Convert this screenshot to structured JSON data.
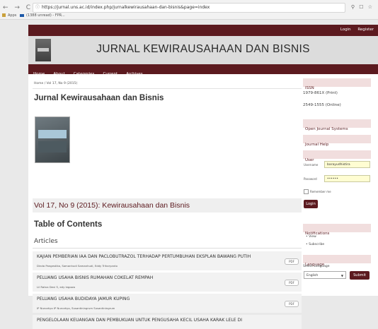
{
  "browser": {
    "nav_glyphs": "← → C ⌂",
    "url": "https://jurnal.uns.ac.id/index.php/jurnalkewirausahaan-dan-bisnis&page=index",
    "ext_glyphs": "⚲ ☐ ☆",
    "bookmarks": [
      "Apps",
      "(1388 unread) - FPR..."
    ]
  },
  "header": {
    "login": "Login",
    "register": "Register",
    "title": "JURNAL KEWIRAUSAHAAN DAN BISNIS"
  },
  "nav": [
    "Home",
    "About",
    "Categories",
    "Current",
    "Archives"
  ],
  "breadcrumb": "Home / Vol 17, No 9 (2015)",
  "page_title": "Jurnal Kewirausahaan dan Bisnis",
  "issue_title": "Vol 17, No 9 (2015): Kewirausahaan dan Bisnis",
  "toc_title": "Table of Contents",
  "articles_heading": "Articles",
  "articles": [
    {
      "title": "KAJIAN PEMBERIAN IAA DAN PACLOBUTRAZOL TERHADAP PERTUMBUHAN EKSPLAN BAWANG PUTIH",
      "authors": "Dinda Pangestika, Samanhudi Samanhudi, Eddy Triharyanto",
      "galley": "PDF"
    },
    {
      "title": "PELUANG USAHA BISNIS RUMAHAN COKELAT REMPAH",
      "authors": "Lil Ratna Devi S, edy legowo",
      "galley": "PDF"
    },
    {
      "title": "PELUANG USAHA BUDIDAYA JAMUR KUPING",
      "authors": "IP Nurcahyo IP Nurcahyo, Susantiningrum Susantiningrum",
      "galley": "PDF"
    },
    {
      "title": "PENGELOLAAN KEUANGAN DAN PEMBUKUAN UNTUK PENGUSAHA KECIL USAHA KARAK LELE DI",
      "authors": "",
      "galley": ""
    }
  ],
  "sidebar": {
    "issn_heading": "ISSN",
    "issn_print": "1979-861X (Print)",
    "issn_online": "2549-1555 (Online)",
    "ojs": "Open Journal Systems",
    "help": "Journal Help",
    "user_heading": "User",
    "username_label": "Username",
    "username_value": "barayudhistira",
    "password_label": "Password",
    "password_value": "••••••",
    "remember_label": "Remember me",
    "login_button": "Login",
    "notifications_heading": "Notifications",
    "notif_view": "View",
    "notif_subscribe": "Subscribe",
    "language_heading": "Language",
    "select_language_label": "Select Language",
    "language_value": "English",
    "submit_button": "Submit"
  }
}
